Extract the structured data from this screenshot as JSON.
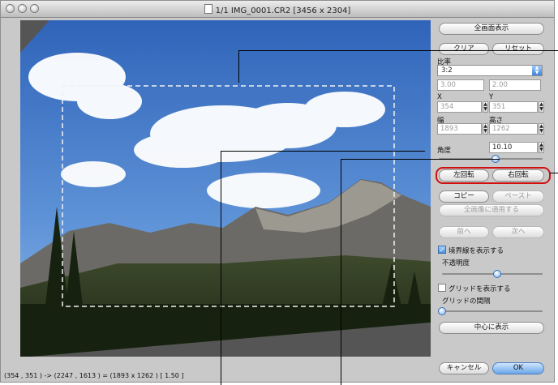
{
  "window": {
    "title": "1/1 IMG_0001.CR2 [3456 x 2304]"
  },
  "toolbar": {
    "fullscreen_label": "全画面表示",
    "clear_label": "クリア",
    "reset_label": "リセット"
  },
  "aspect": {
    "label": "比率",
    "selected": "3:2",
    "width_value": "3.00",
    "height_value": "2.00"
  },
  "position": {
    "x_label": "X",
    "y_label": "Y",
    "x_value": "354",
    "y_value": "351"
  },
  "size": {
    "width_label": "幅",
    "height_label": "高さ",
    "width_value": "1893",
    "height_value": "1262"
  },
  "angle": {
    "label": "角度",
    "value": "10.10",
    "slider_fraction": 0.55
  },
  "rotate": {
    "left_label": "左回転",
    "right_label": "右回転"
  },
  "copy": {
    "copy_label": "コピー",
    "paste_label": "ペースト",
    "apply_all_label": "全画像に適用する"
  },
  "nav": {
    "prev_label": "前へ",
    "next_label": "次へ"
  },
  "border": {
    "show_label": "境界線を表示する",
    "checked": true,
    "opacity_label": "不透明度",
    "opacity_fraction": 0.55
  },
  "grid": {
    "show_label": "グリッドを表示する",
    "checked": false,
    "spacing_label": "グリッドの間隔",
    "spacing_fraction": 0.0
  },
  "center_label": "中心に表示",
  "footer": {
    "cancel_label": "キャンセル",
    "ok_label": "OK"
  },
  "status": {
    "readout": "(354 , 351 ) -> (2247 , 1613 ) = (1893 x 1262 ) [ 1.50 ]"
  },
  "colors": {
    "accent": "#4a8fe0",
    "highlight_oval": "#d01010",
    "canvas_bg": "#555555"
  }
}
